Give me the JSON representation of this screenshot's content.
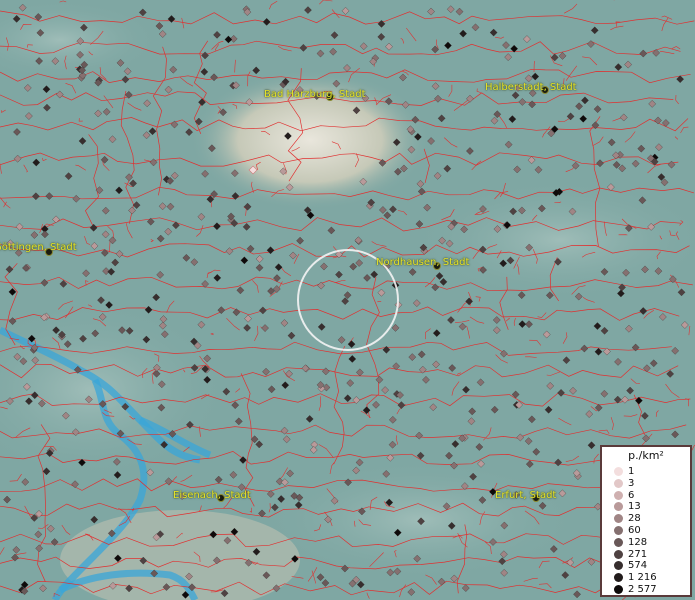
{
  "cities": [
    {
      "name": "Bad Harzburg, Stadt"
    },
    {
      "name": "Halberstadt, Stadt"
    },
    {
      "name": "Göttingen, Stadt"
    },
    {
      "name": "Nordhausen, Stadt"
    },
    {
      "name": "Eisenach, Stadt"
    },
    {
      "name": "Erfurt, Stadt"
    }
  ],
  "legend": {
    "title": "p./km²",
    "entries": [
      {
        "label": "1",
        "color": "#f3dede"
      },
      {
        "label": "3",
        "color": "#e2c8c8"
      },
      {
        "label": "6",
        "color": "#cfb0b0"
      },
      {
        "label": "13",
        "color": "#b99a9a"
      },
      {
        "label": "28",
        "color": "#a08585"
      },
      {
        "label": "60",
        "color": "#857070"
      },
      {
        "label": "128",
        "color": "#695858"
      },
      {
        "label": "271",
        "color": "#4f4242"
      },
      {
        "label": "574",
        "color": "#372e2e"
      },
      {
        "label": "1 216",
        "color": "#221c1c"
      },
      {
        "label": "2 577",
        "color": "#0e0a0a"
      }
    ]
  },
  "colors": {
    "boundary": "#e03030",
    "river": "#3aa6d8",
    "terrain": "#7fa7a3"
  }
}
